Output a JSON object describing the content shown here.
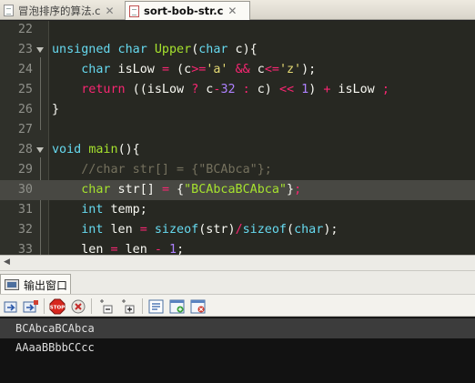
{
  "tabs": [
    {
      "label": "冒泡排序的算法.c",
      "close": "✕"
    },
    {
      "label": "sort-bob-str.c",
      "close": "✕"
    }
  ],
  "editor": {
    "lines": [
      {
        "num": "22",
        "html": ""
      },
      {
        "num": "23",
        "html": "<span class='ty'>unsigned char</span> <span class='fn'>Upper</span>(<span class='ty'>char</span> c){"
      },
      {
        "num": "24",
        "html": "    <span class='ty'>char</span> isLow <span class='op'>=</span> (c<span class='op'>&gt;=</span><span class='str'>'a'</span> <span class='op'>&amp;&amp;</span> c<span class='op'>&lt;=</span><span class='str'>'z'</span>);"
      },
      {
        "num": "25",
        "html": "    <span class='kw'>return</span> ((isLow <span class='op'>?</span> c<span class='op'>-</span><span class='num'>32</span> <span class='op'>:</span> c) <span class='op'>&lt;&lt;</span> <span class='num'>1</span>) <span class='op'>+</span> isLow <span class='op'>;</span>"
      },
      {
        "num": "26",
        "html": "}"
      },
      {
        "num": "27",
        "html": ""
      },
      {
        "num": "28",
        "html": "<span class='ty'>void</span> <span class='fn'>main</span>(){"
      },
      {
        "num": "29",
        "html": "    <span class='cm'>//char str[] = {\"BCAbca\"};</span>"
      },
      {
        "num": "30",
        "html": "    <span class='gr'>char</span> str[] <span class='op'>=</span> {<span class='gr'>\"BCAbcaBCAbca\"</span>}<span class='op'>;</span>"
      },
      {
        "num": "31",
        "html": "    <span class='ty'>int</span> temp;"
      },
      {
        "num": "32",
        "html": "    <span class='ty'>int</span> len <span class='op'>=</span> <span class='ty'>sizeof</span>(str)<span class='op'>/</span><span class='ty'>sizeof</span>(<span class='ty'>char</span>);"
      },
      {
        "num": "33",
        "html": "    len <span class='op'>=</span> len <span class='op'>-</span> <span class='num'>1</span>;"
      }
    ],
    "fold_lines": [
      "23",
      "28"
    ],
    "current_line": "30"
  },
  "output_panel": {
    "tab_label": "输出窗口",
    "toolbar_icons": [
      "rerun-icon",
      "rerun-alt-icon",
      "stop-icon",
      "kill-icon",
      "prev-error-icon",
      "next-error-icon",
      "options-icon",
      "new-tab-icon",
      "close-tab-icon"
    ],
    "lines": [
      "BCAbcaBCAbca",
      "AAaaBBbbCCcc"
    ]
  },
  "colors": {
    "editor_bg": "#272822",
    "keyword": "#f92672",
    "type": "#66d9ef",
    "function": "#a6e22e",
    "string": "#e6db74",
    "number": "#ae81ff",
    "comment": "#75715e"
  }
}
